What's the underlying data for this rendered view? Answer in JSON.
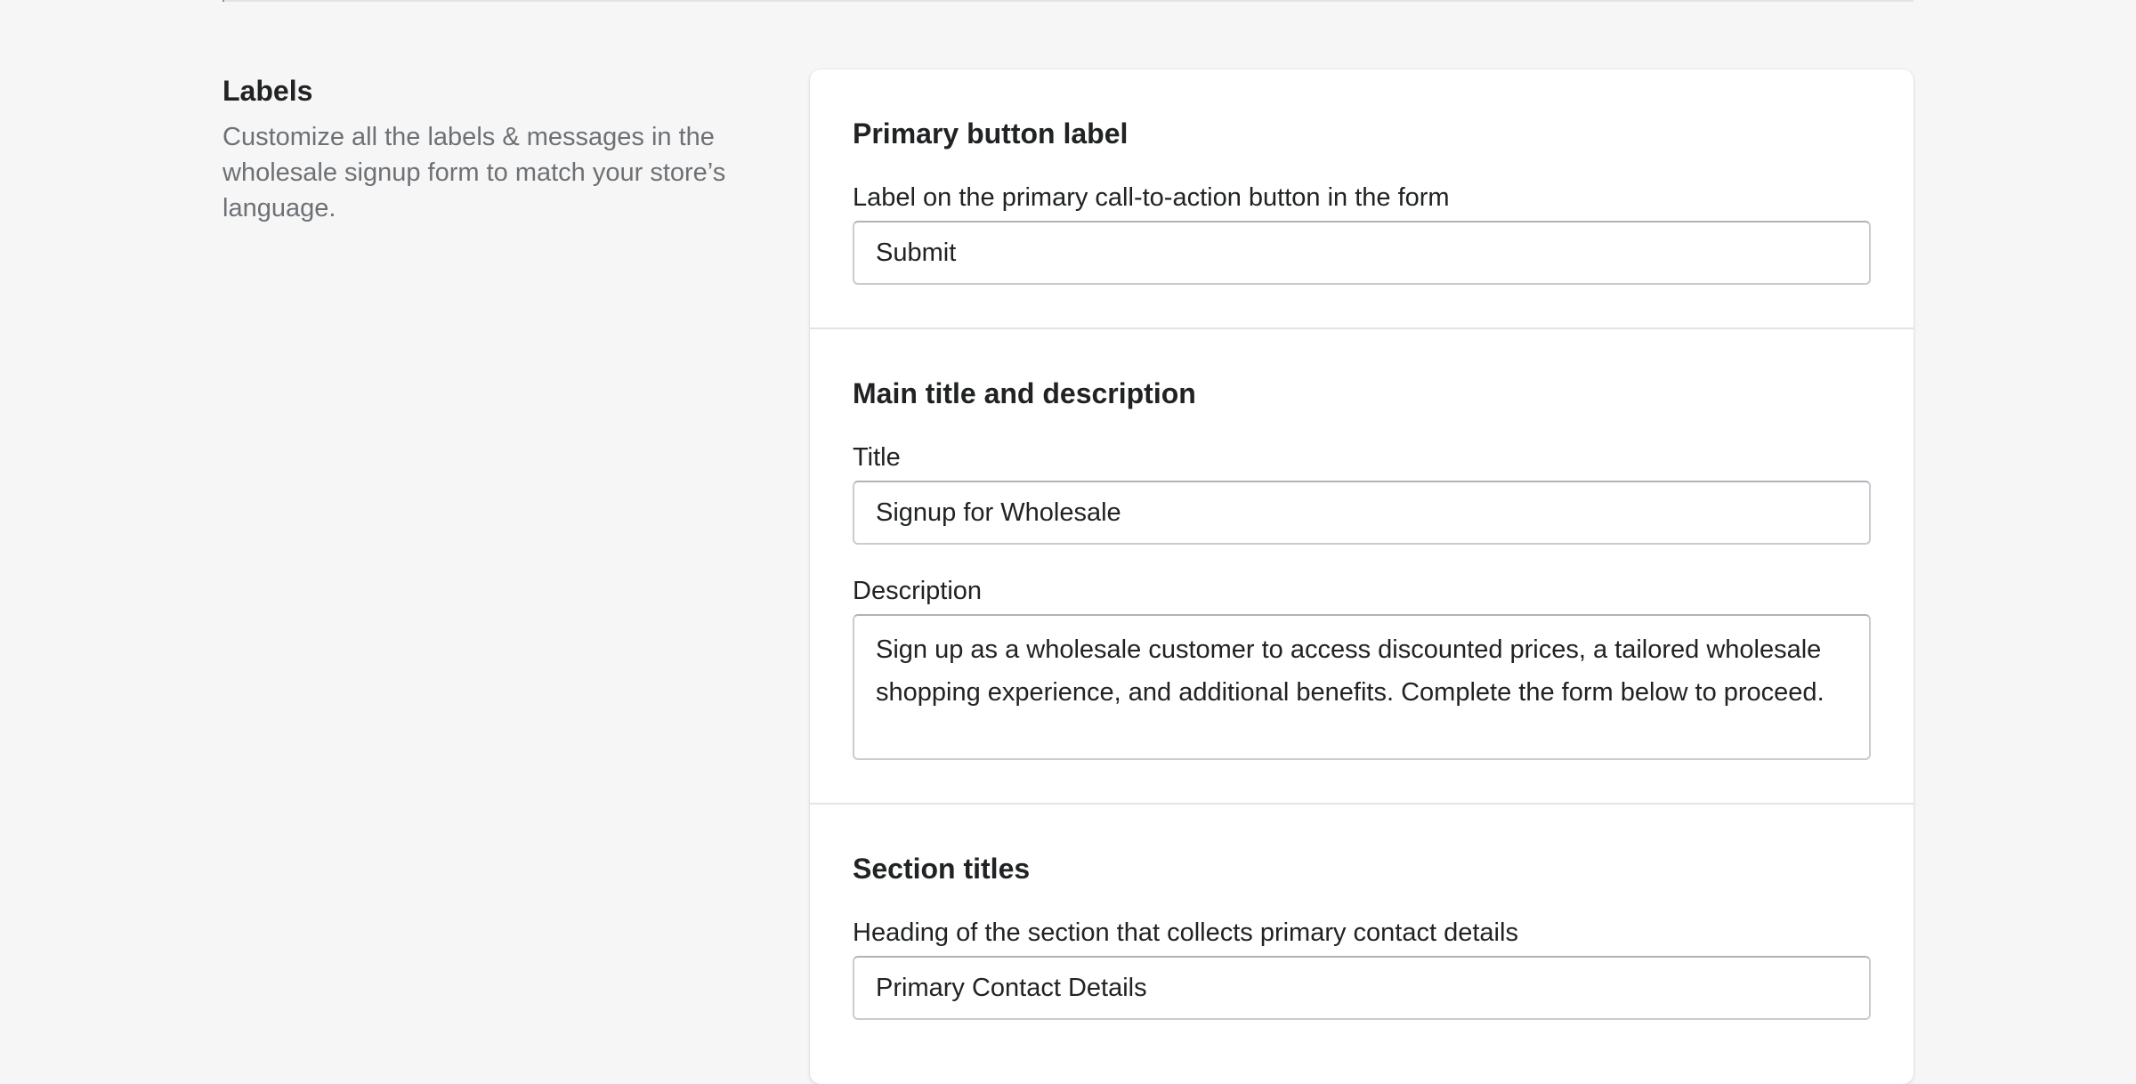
{
  "annotation": {
    "title": "Labels",
    "description": "Customize all the labels & messages in the wholesale signup form to match your store’s language."
  },
  "sections": {
    "primary_button": {
      "title": "Primary button label",
      "field_label": "Label on the primary call-to-action button in the form",
      "field_value": "Submit"
    },
    "main_title": {
      "title": "Main title and description",
      "title_label": "Title",
      "title_value": "Signup for Wholesale",
      "description_label": "Description",
      "description_value": "Sign up as a wholesale customer to access discounted prices, a tailored wholesale shopping experience, and additional benefits. Complete the form below to proceed."
    },
    "section_titles": {
      "title": "Section titles",
      "contact_label": "Heading of the section that collects primary contact details",
      "contact_value": "Primary Contact Details"
    }
  },
  "colors": {
    "page_background": "#f6f6f6",
    "card_background": "#ffffff",
    "text_primary": "#202223",
    "text_subdued": "#6d7175",
    "border": "#c9cccf"
  }
}
